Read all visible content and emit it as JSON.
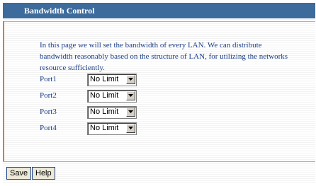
{
  "header": {
    "title": "Bandwidth Control"
  },
  "intro": {
    "line1": "In this page we will set the bandwidth of every LAN. We can distribute",
    "line2": "bandwidth reasonably based on the structure of LAN, for utilizing the networks",
    "line3": "resource sufficiently."
  },
  "ports": [
    {
      "label": "Port1",
      "value": "No Limit"
    },
    {
      "label": "Port2",
      "value": "No Limit"
    },
    {
      "label": "Port3",
      "value": "No Limit"
    },
    {
      "label": "Port4",
      "value": "No Limit"
    }
  ],
  "buttons": {
    "save": "Save",
    "help": "Help"
  },
  "colors": {
    "header_bg": "#3d6b9c",
    "accent": "#f7a23d",
    "text": "#1a3e86"
  },
  "icons": {
    "select_arrow": "chevron-down-icon"
  }
}
